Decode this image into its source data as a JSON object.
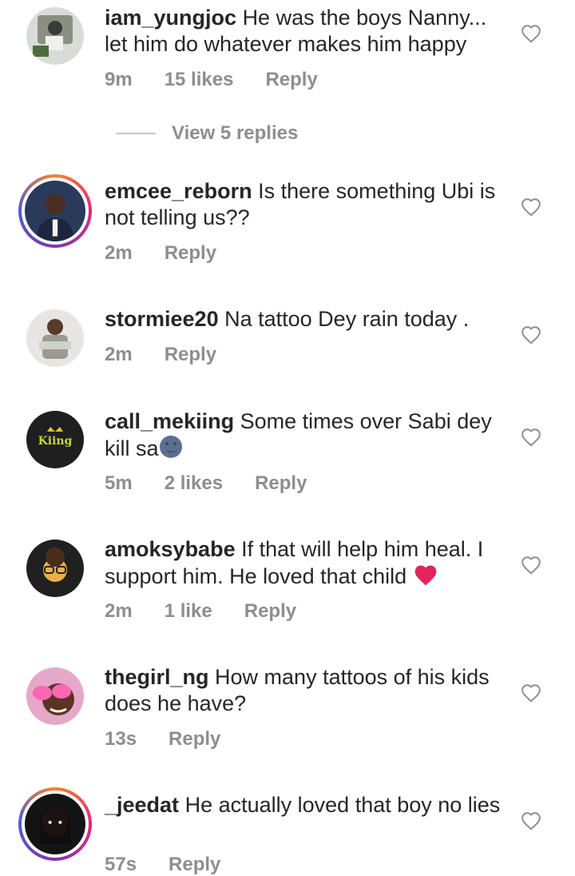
{
  "comments": [
    {
      "username": "iam_yungjoc",
      "text": "He was the boys Nanny... let him do whatever makes him happy",
      "time": "9m",
      "likes": "15 likes",
      "reply": "Reply"
    },
    {
      "username": "emcee_reborn",
      "text": "Is there something Ubi is not telling us??",
      "time": "2m",
      "likes": "",
      "reply": "Reply"
    },
    {
      "username": "stormiee20",
      "text": "Na tattoo Dey rain today .",
      "time": "2m",
      "likes": "",
      "reply": "Reply"
    },
    {
      "username": "call_mekiing",
      "text": "Some times over Sabi dey kill sa",
      "time": "5m",
      "likes": "2 likes",
      "reply": "Reply"
    },
    {
      "username": "amoksybabe",
      "text": "If that will help him heal. I support him. He loved that child",
      "time": "2m",
      "likes": "1 like",
      "reply": "Reply"
    },
    {
      "username": "thegirl_ng",
      "text": "How many tattoos of his kids does he have?",
      "time": "13s",
      "likes": "",
      "reply": "Reply"
    },
    {
      "username": "_jeedat",
      "text": "He actually loved that boy no lies",
      "time": "57s",
      "likes": "",
      "reply": "Reply"
    }
  ],
  "view_replies": "View 5 replies",
  "icons": {
    "like": "heart-outline-icon",
    "emoji1": "new-moon-face-emoji",
    "emoji2": "red-heart-emoji"
  },
  "colors": {
    "text": "#262626",
    "meta": "#8e8e8e",
    "heart": "#e0245e"
  }
}
